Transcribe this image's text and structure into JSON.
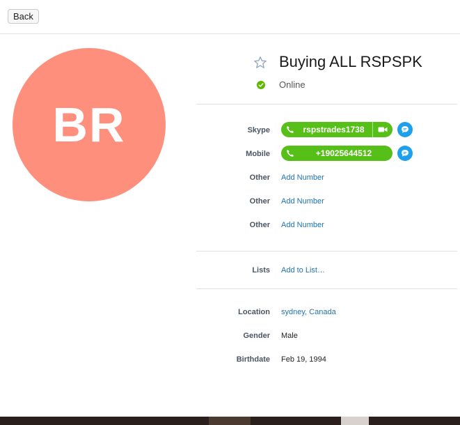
{
  "toolbar": {
    "back_label": "Back"
  },
  "profile": {
    "initials": "BR",
    "avatar_color": "#ff8f7d",
    "name": "Buying ALL RSPSPK",
    "status": "Online",
    "status_color": "#5fb800",
    "favorite_icon": "star-outline-icon"
  },
  "contacts": {
    "skype": {
      "label": "Skype",
      "value": "rspstrades1738"
    },
    "mobile": {
      "label": "Mobile",
      "value": "+19025644512"
    },
    "others": [
      {
        "label": "Other",
        "action": "Add Number"
      },
      {
        "label": "Other",
        "action": "Add Number"
      },
      {
        "label": "Other",
        "action": "Add Number"
      }
    ],
    "pill_color": "#56c018",
    "chat_color": "#1ea1ec"
  },
  "lists": {
    "label": "Lists",
    "action": "Add to List…"
  },
  "details": {
    "location": {
      "label": "Location",
      "value": "sydney, Canada"
    },
    "gender": {
      "label": "Gender",
      "value": "Male"
    },
    "birthdate": {
      "label": "Birthdate",
      "value": "Feb 19, 1994"
    }
  },
  "link_color": "#1c73b5"
}
